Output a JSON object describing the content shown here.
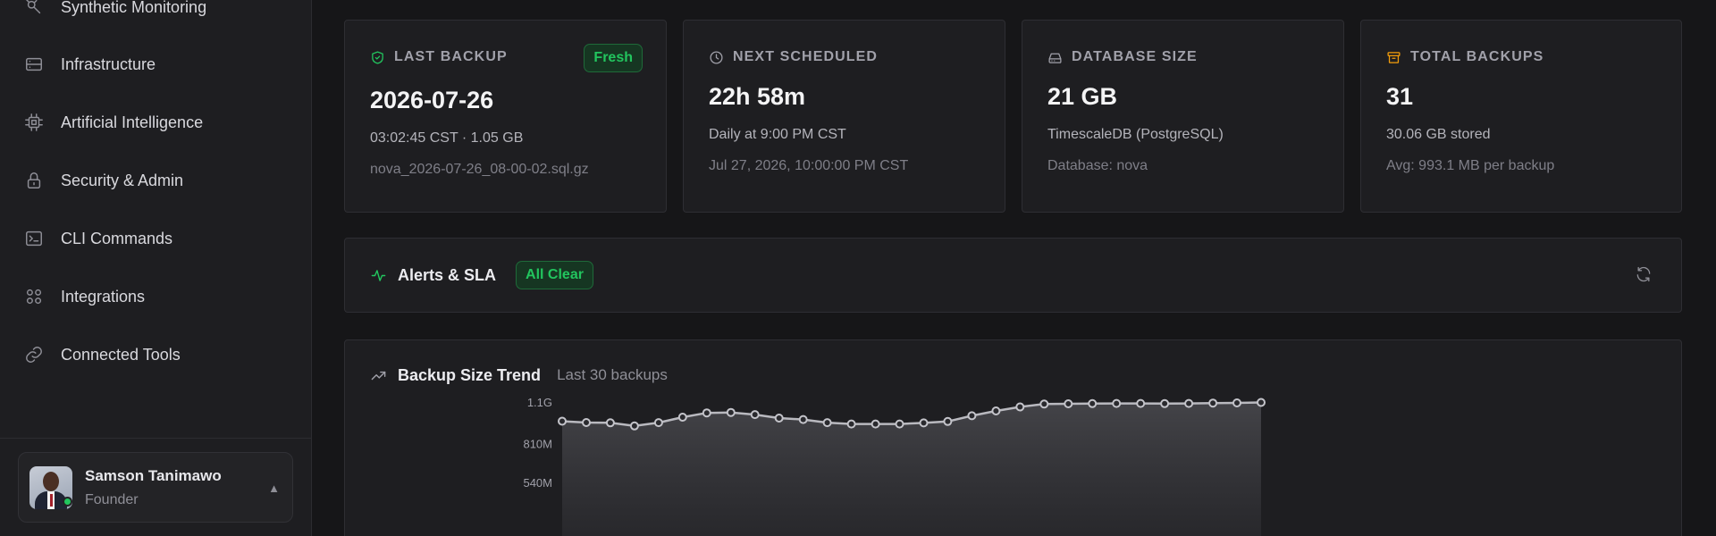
{
  "sidebar": {
    "items": [
      {
        "label": "Synthetic Monitoring",
        "icon": "synthetic-monitoring-icon"
      },
      {
        "label": "Infrastructure",
        "icon": "server-icon"
      },
      {
        "label": "Artificial Intelligence",
        "icon": "cpu-icon"
      },
      {
        "label": "Security & Admin",
        "icon": "lock-icon"
      },
      {
        "label": "CLI Commands",
        "icon": "terminal-icon"
      },
      {
        "label": "Integrations",
        "icon": "grid-icon"
      },
      {
        "label": "Connected Tools",
        "icon": "link-icon"
      }
    ],
    "user": {
      "name": "Samson Tanimawo",
      "role": "Founder",
      "chevron": "▲"
    }
  },
  "stats": [
    {
      "title": "LAST BACKUP",
      "icon": "shield-check-icon",
      "value": "2026-07-26",
      "sub": "03:02:45 CST · 1.05 GB",
      "muted": "nova_2026-07-26_08-00-02.sql.gz",
      "badge": "Fresh",
      "icon_color": "#22c55e"
    },
    {
      "title": "NEXT SCHEDULED",
      "icon": "clock-icon",
      "value": "22h 58m",
      "sub": "Daily at 9:00 PM CST",
      "muted": "Jul 27, 2026, 10:00:00 PM CST",
      "icon_color": "#a1a1aa"
    },
    {
      "title": "DATABASE SIZE",
      "icon": "hard-drive-icon",
      "value": "21 GB",
      "sub": "TimescaleDB (PostgreSQL)",
      "muted": "Database: nova",
      "icon_color": "#a1a1aa"
    },
    {
      "title": "TOTAL BACKUPS",
      "icon": "archive-icon",
      "value": "31",
      "sub": "30.06 GB stored",
      "muted": "Avg: 993.1 MB per backup",
      "icon_color": "#f59e0b"
    }
  ],
  "alerts": {
    "title": "Alerts & SLA",
    "badge": "All Clear"
  },
  "trend": {
    "title": "Backup Size Trend",
    "subtitle": "Last 30 backups"
  },
  "chart_data": {
    "type": "area",
    "title": "Backup Size Trend",
    "subtitle": "Last 30 backups",
    "xlabel": "",
    "ylabel": "",
    "unit": "MB",
    "yticks": [
      {
        "value": 1100,
        "label": "1.1G"
      },
      {
        "value": 810,
        "label": "810M"
      },
      {
        "value": 540,
        "label": "540M"
      }
    ],
    "values": [
      972,
      963,
      961,
      939,
      962,
      1000,
      1030,
      1033,
      1018,
      994,
      984,
      962,
      953,
      953,
      953,
      960,
      970,
      1010,
      1044,
      1072,
      1092,
      1094,
      1095,
      1096,
      1096,
      1095,
      1096,
      1099,
      1100,
      1103
    ]
  }
}
